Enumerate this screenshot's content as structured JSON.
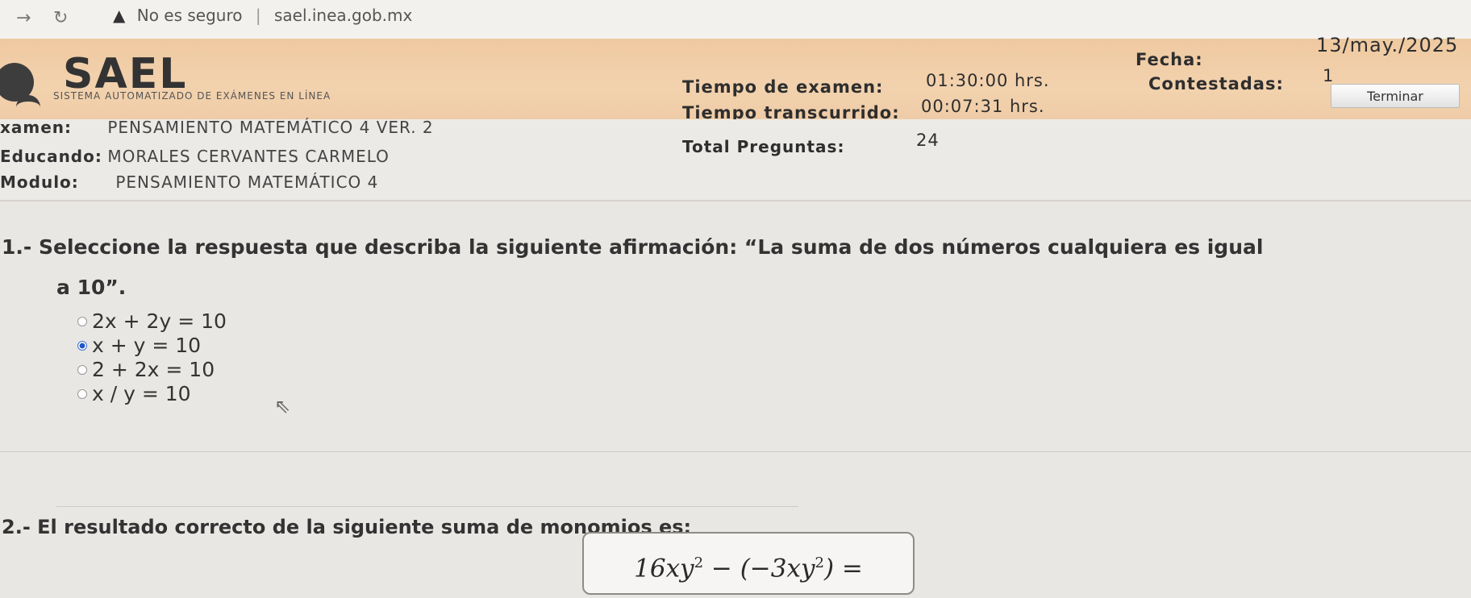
{
  "browser": {
    "insecure_label": "No es seguro",
    "url": "sael.inea.gob.mx"
  },
  "header": {
    "logo_text": "SAEL",
    "logo_subtitle": "SISTEMA AUTOMATIZADO DE EXÁMENES EN LÍNEA",
    "exam_time_label": "Tiempo de examen:",
    "exam_time_value": "01:30:00 hrs.",
    "elapsed_label": "Tiempo transcurrido:",
    "elapsed_value": "00:07:31 hrs.",
    "total_label": "Total Preguntas:",
    "total_value": "24",
    "date_label": "Fecha:",
    "date_value": "13/may./2025",
    "answered_label": "Contestadas:",
    "answered_value": "1",
    "terminate_label": "Terminar"
  },
  "exam_info": {
    "exam_label": "xamen:",
    "exam_value": "PENSAMIENTO MATEMÁTICO 4 VER. 2",
    "student_label": "Educando:",
    "student_value": "MORALES CERVANTES CARMELO",
    "module_label": "Modulo:",
    "module_value": "PENSAMIENTO MATEMÁTICO 4"
  },
  "questions": [
    {
      "number": "1.-",
      "text_line1": "Seleccione la respuesta que describa la siguiente afirmación: “La suma de dos números cualquiera es igual",
      "text_line2": "a 10”.",
      "options": [
        "2x + 2y = 10",
        "x + y = 10",
        "2 + 2x = 10",
        "x / y = 10"
      ],
      "selected_index": 1
    },
    {
      "number": "2.-",
      "text": "El resultado correcto de la siguiente suma de monomios es:",
      "formula": "16xy² − (−3xy²) ="
    }
  ],
  "colors": {
    "header_band": "#f0cda6",
    "selected_radio": "#1f56c8"
  }
}
